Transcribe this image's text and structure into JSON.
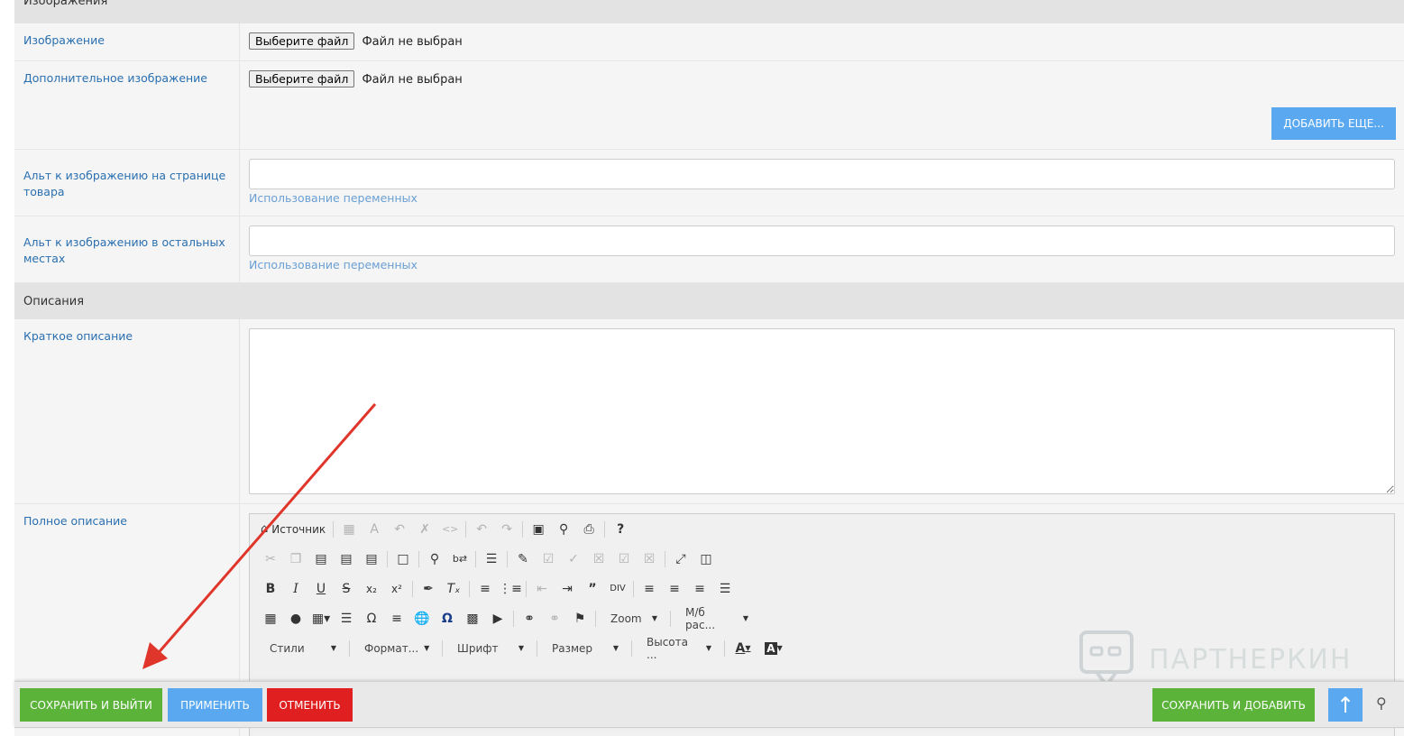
{
  "sections": {
    "images": "Изображения",
    "descriptions": "Описания"
  },
  "image_field": {
    "label": "Изображение",
    "button": "Выберите файл",
    "status": "Файл не выбран"
  },
  "extra_image_field": {
    "label": "Дополнительное изображение",
    "button": "Выберите файл",
    "status": "Файл не выбран",
    "add_more": "ДОБАВИТЬ ЕЩЕ..."
  },
  "alt_product": {
    "label": "Альт к изображению на странице товара",
    "value": "",
    "hint": "Использование переменных"
  },
  "alt_other": {
    "label": "Альт к изображению в остальных местах",
    "value": "",
    "hint": "Использование переменных"
  },
  "short_desc": {
    "label": "Краткое описание"
  },
  "full_desc": {
    "label": "Полное описание"
  },
  "editor": {
    "source": "Источник",
    "zoom": "Zoom",
    "line_spacing": "М/б рас...",
    "styles": "Стили",
    "format": "Формат...",
    "font": "Шрифт",
    "size": "Размер",
    "height": "Высота ..."
  },
  "bottom_bar": {
    "save_exit": "СОХРАНИТЬ И ВЫЙТИ",
    "apply": "ПРИМЕНИТЬ",
    "cancel": "ОТМЕНИТЬ",
    "save_add": "СОХРАНИТЬ И ДОБАВИТЬ"
  },
  "watermark": "ПАРТНЕРКИН",
  "colors": {
    "green": "#5bb33a",
    "blue": "#5aa9f0",
    "red": "#e02020",
    "annotation_arrow": "#e0352b"
  }
}
